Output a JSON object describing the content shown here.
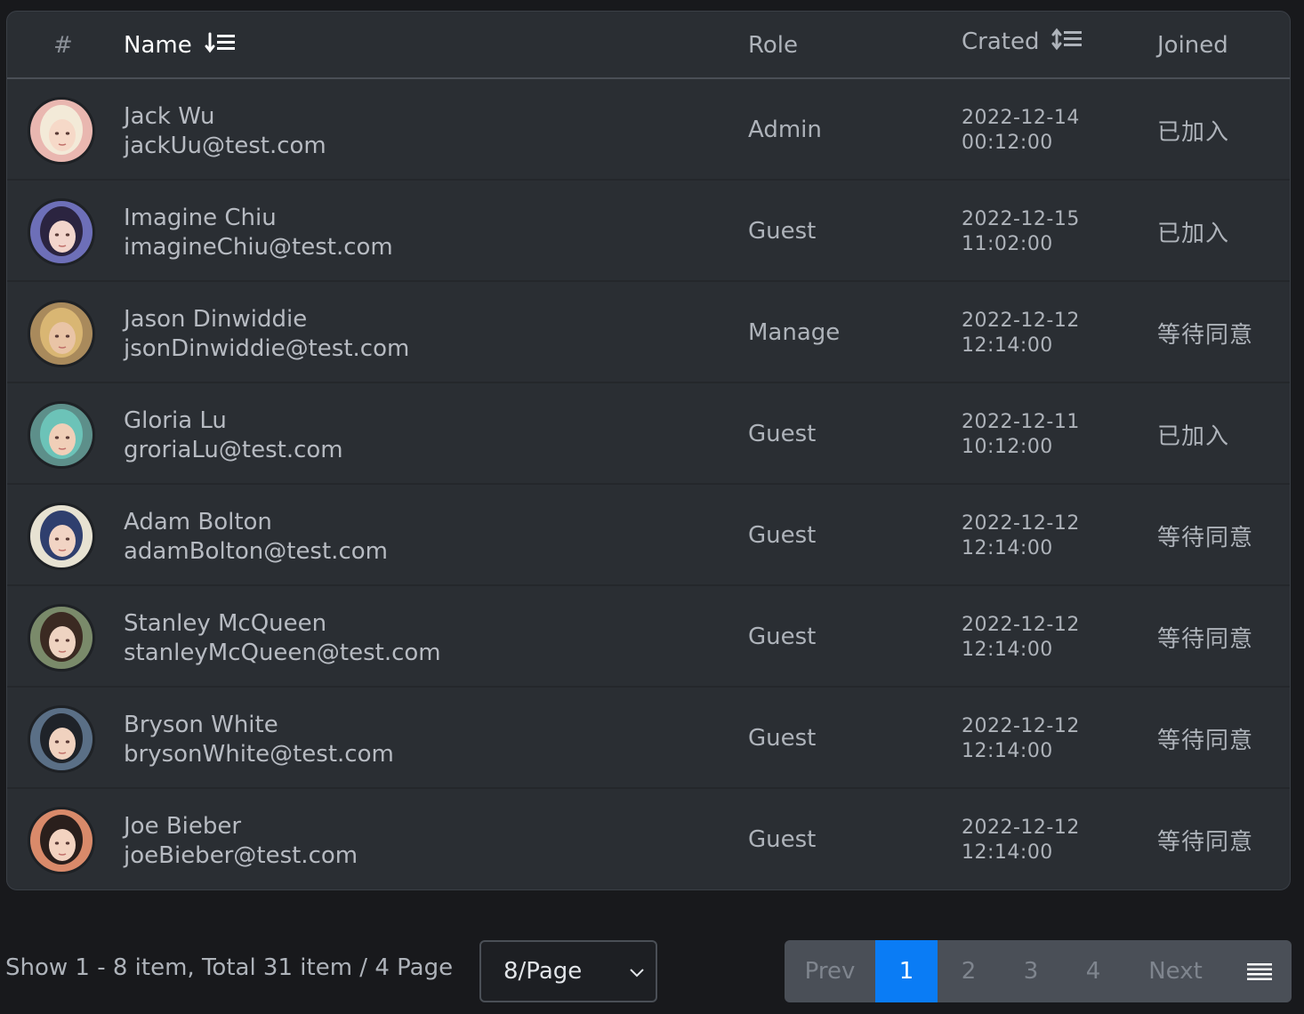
{
  "header": {
    "hash": "#",
    "name": "Name",
    "role": "Role",
    "crated": "Crated",
    "joined": "Joined",
    "sort_icon": "sort-desc-list-icon"
  },
  "rows": [
    {
      "name": "Jack Wu",
      "email": "jackUu@test.com",
      "role": "Admin",
      "date": "2022-12-14",
      "time": "00:12:00",
      "joined": "已加入",
      "avatar": "avatar-1"
    },
    {
      "name": "Imagine Chiu",
      "email": "imagineChiu@test.com",
      "role": "Guest",
      "date": "2022-12-15",
      "time": "11:02:00",
      "joined": "已加入",
      "avatar": "avatar-2"
    },
    {
      "name": "Jason Dinwiddie",
      "email": "jsonDinwiddie@test.com",
      "role": "Manage",
      "date": "2022-12-12",
      "time": "12:14:00",
      "joined": "等待同意",
      "avatar": "avatar-3"
    },
    {
      "name": "Gloria Lu",
      "email": "groriaLu@test.com",
      "role": "Guest",
      "date": "2022-12-11",
      "time": "10:12:00",
      "joined": "已加入",
      "avatar": "avatar-4"
    },
    {
      "name": "Adam Bolton",
      "email": "adamBolton@test.com",
      "role": "Guest",
      "date": "2022-12-12",
      "time": "12:14:00",
      "joined": "等待同意",
      "avatar": "avatar-5"
    },
    {
      "name": "Stanley McQueen",
      "email": "stanleyMcQueen@test.com",
      "role": "Guest",
      "date": "2022-12-12",
      "time": "12:14:00",
      "joined": "等待同意",
      "avatar": "avatar-6"
    },
    {
      "name": "Bryson White",
      "email": "brysonWhite@test.com",
      "role": "Guest",
      "date": "2022-12-12",
      "time": "12:14:00",
      "joined": "等待同意",
      "avatar": "avatar-7"
    },
    {
      "name": "Joe Bieber",
      "email": "joeBieber@test.com",
      "role": "Guest",
      "date": "2022-12-12",
      "time": "12:14:00",
      "joined": "等待同意",
      "avatar": "avatar-8"
    }
  ],
  "footer": {
    "info": "Show 1 - 8 item, Total 31 item / 4 Page",
    "page_size": "8/Page",
    "prev": "Prev",
    "pages": [
      "1",
      "2",
      "3",
      "4"
    ],
    "next": "Next",
    "active_page": "1"
  },
  "colors": {
    "background": "#18191c",
    "card": "#2a2e33",
    "accent": "#0a7cf5",
    "pager_bg": "#4a4f57"
  }
}
